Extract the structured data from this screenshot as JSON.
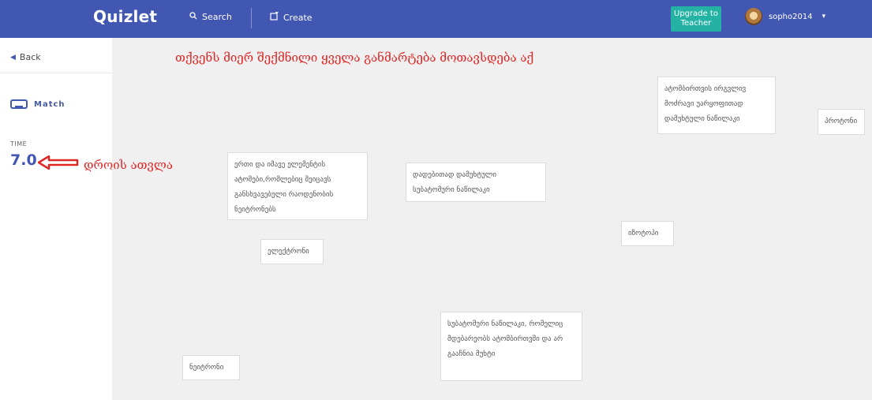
{
  "header": {
    "logo": "Quizlet",
    "search_label": "Search",
    "create_label": "Create",
    "upgrade_line1": "Upgrade to",
    "upgrade_line2": "Teacher",
    "username": "sopho2014",
    "colors": {
      "bar": "#4257b2",
      "upgrade": "#23b2a4"
    }
  },
  "sidebar": {
    "back_label": "Back",
    "mode_label": "Match",
    "time_label": "TIME",
    "time_value": "7.0"
  },
  "annotations": {
    "top": "თქვენს მიერ შექმნილი ყველა  განმარტება მოთავსდება აქ",
    "time": "დროის ათვლა",
    "color": "#e02828"
  },
  "cards": [
    {
      "text": "ატომბირთვის ირგვლივ მოძრავი უარყოფითად დამუხტული ნაწილაკი"
    },
    {
      "text": "პროტონი"
    },
    {
      "text": "ერთი და იმავე ელემენტის ატომები,რომლებიც შეიცავს განსხვავებული რაოდენობის ნეიტრონებს"
    },
    {
      "text": "დადებითად დამუხტული სუბატომური ნაწილაკი"
    },
    {
      "text": "იზოტოპი"
    },
    {
      "text": "ელექტრონი"
    },
    {
      "text": "სუბატომური ნაწილაკი, რომელიც მდებარეობს ატომბირთვში და არ გააჩნია მუხტი"
    },
    {
      "text": "ნეიტრონი"
    }
  ]
}
